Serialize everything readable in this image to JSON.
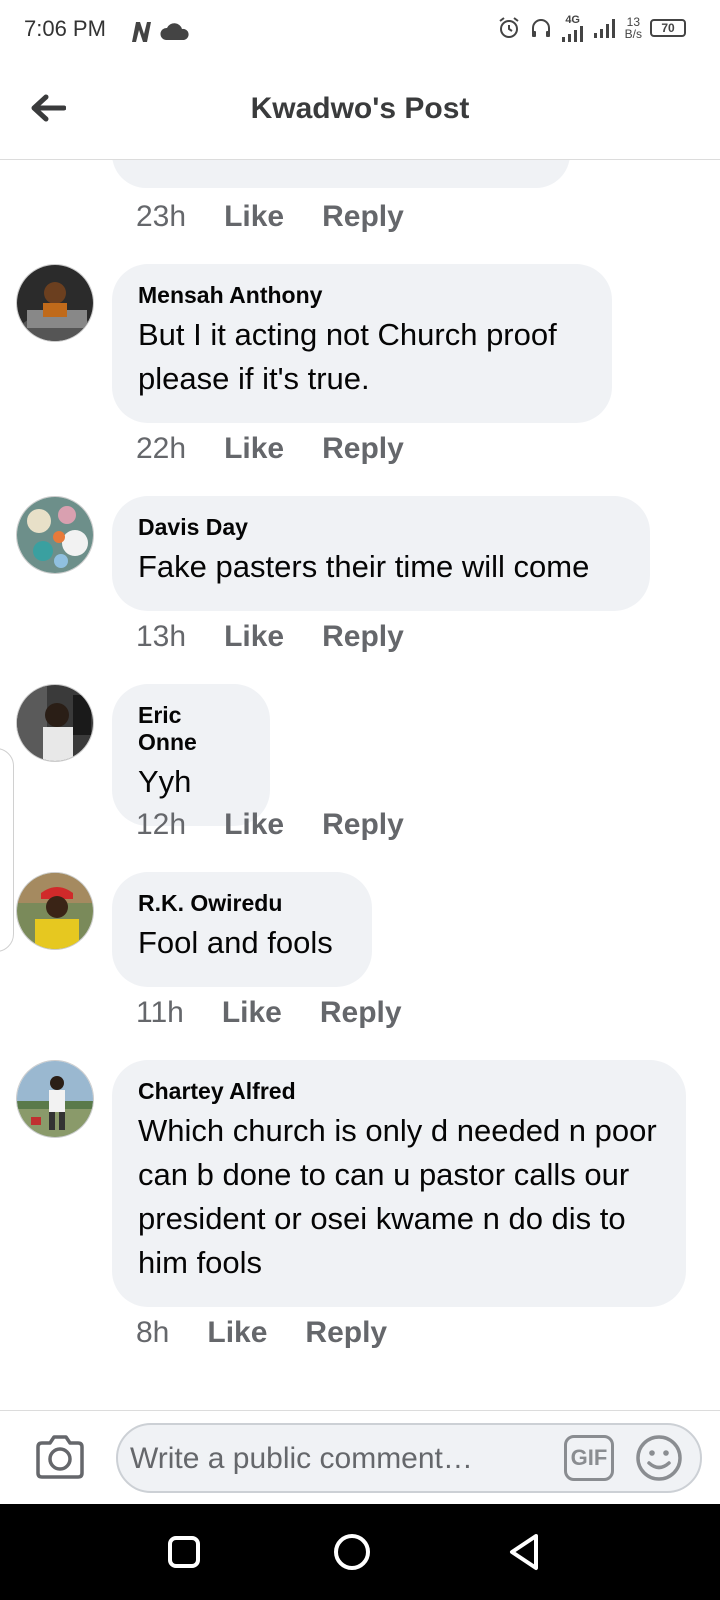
{
  "status_bar": {
    "time": "7:06 PM",
    "network": "4G",
    "speed_value": "13",
    "speed_unit": "B/s",
    "battery": "70"
  },
  "header": {
    "title": "Kwadwo's Post"
  },
  "partial_comment": {
    "time": "23h",
    "like_label": "Like",
    "reply_label": "Reply"
  },
  "comments": [
    {
      "author": "Mensah Anthony",
      "text": "But I it acting not Church proof please if it's true.",
      "time": "22h",
      "like_label": "Like",
      "reply_label": "Reply"
    },
    {
      "author": "Davis Day",
      "text": "Fake pasters their time will come",
      "time": "13h",
      "like_label": "Like",
      "reply_label": "Reply"
    },
    {
      "author": "Eric Onne",
      "text": "Yyh",
      "time": "12h",
      "like_label": "Like",
      "reply_label": "Reply"
    },
    {
      "author": "R.K. Owiredu",
      "text": "Fool and fools",
      "time": "11h",
      "like_label": "Like",
      "reply_label": "Reply"
    },
    {
      "author": "Chartey Alfred",
      "text": "Which church is only d needed n poor can b done to can u pastor calls our president or osei kwame n do dis to him fools",
      "time": "8h",
      "like_label": "Like",
      "reply_label": "Reply"
    }
  ],
  "composer": {
    "placeholder": "Write a public comment…",
    "gif_label": "GIF"
  },
  "colors": {
    "bubble": "#f0f2f5",
    "secondary_text": "#65676b",
    "primary_text": "#050505"
  }
}
